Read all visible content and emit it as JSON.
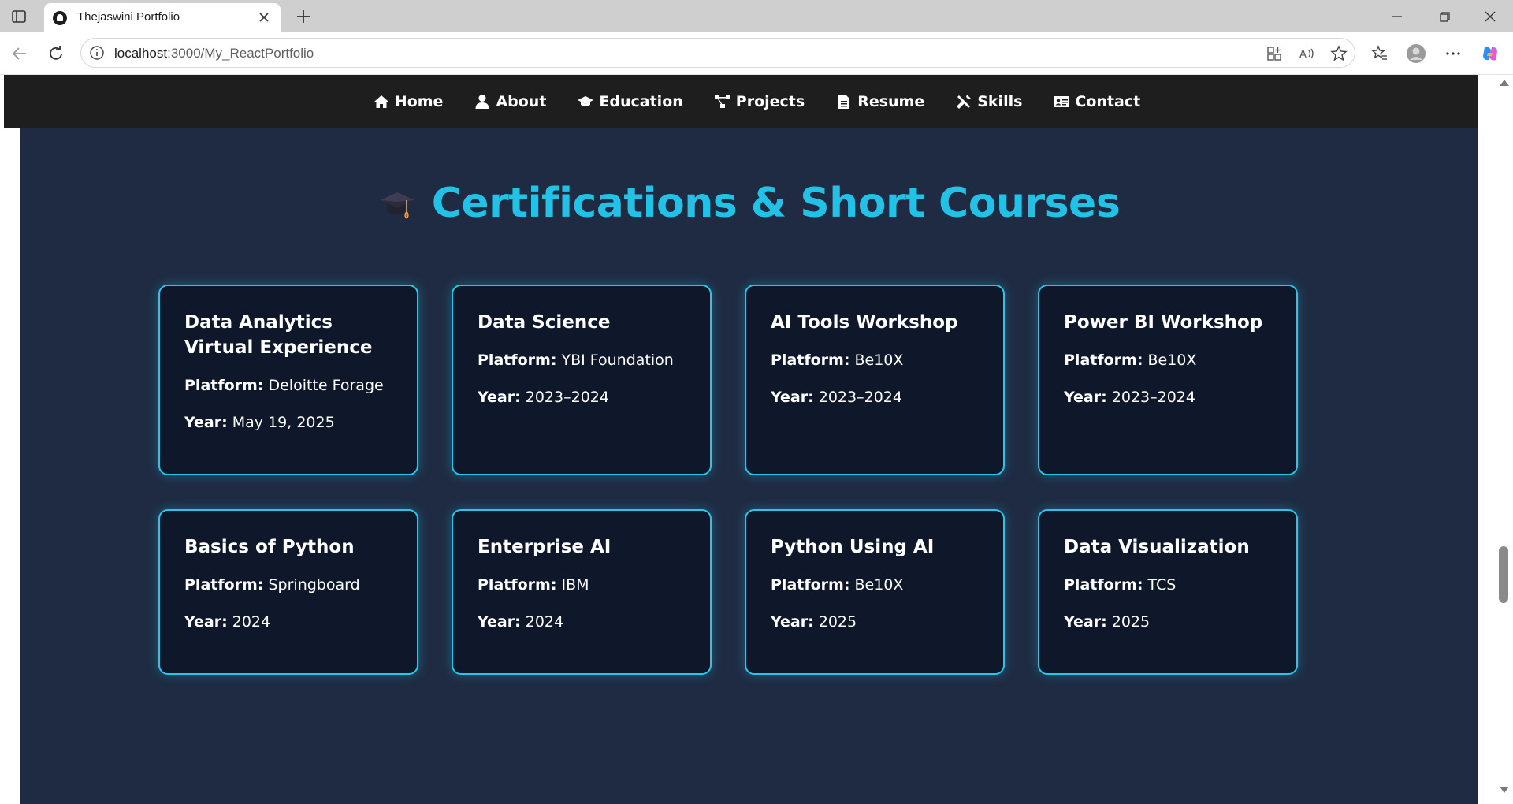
{
  "browser": {
    "tab_title": "Thejaswini Portfolio",
    "url_host": "localhost",
    "url_path": ":3000/My_ReactPortfolio"
  },
  "nav": {
    "items": [
      {
        "label": "Home",
        "icon": "home-icon"
      },
      {
        "label": "About",
        "icon": "user-icon"
      },
      {
        "label": "Education",
        "icon": "graduation-cap-icon"
      },
      {
        "label": "Projects",
        "icon": "project-diagram-icon"
      },
      {
        "label": "Resume",
        "icon": "file-icon"
      },
      {
        "label": "Skills",
        "icon": "tools-icon"
      },
      {
        "label": "Contact",
        "icon": "address-card-icon"
      }
    ]
  },
  "section": {
    "title": "Certifications & Short Courses",
    "title_icon": "graduation-cap-emoji",
    "platform_label": "Platform:",
    "year_label": "Year:",
    "certifications": [
      {
        "title": "Data Analytics Virtual Experience",
        "platform": "Deloitte Forage",
        "year": "May 19, 2025"
      },
      {
        "title": "Data Science",
        "platform": "YBI Foundation",
        "year": "2023–2024"
      },
      {
        "title": "AI Tools Workshop",
        "platform": "Be10X",
        "year": "2023–2024"
      },
      {
        "title": "Power BI Workshop",
        "platform": "Be10X",
        "year": "2023–2024"
      },
      {
        "title": "Basics of Python",
        "platform": "Springboard",
        "year": "2024"
      },
      {
        "title": "Enterprise AI",
        "platform": "IBM",
        "year": "2024"
      },
      {
        "title": "Python Using AI",
        "platform": "Be10X",
        "year": "2025"
      },
      {
        "title": "Data Visualization",
        "platform": "TCS",
        "year": "2025"
      }
    ]
  },
  "colors": {
    "accent": "#22c2e6",
    "section_bg": "#1f2b43",
    "card_bg": "#0f172a",
    "navbar_bg": "#1e1e1e"
  }
}
